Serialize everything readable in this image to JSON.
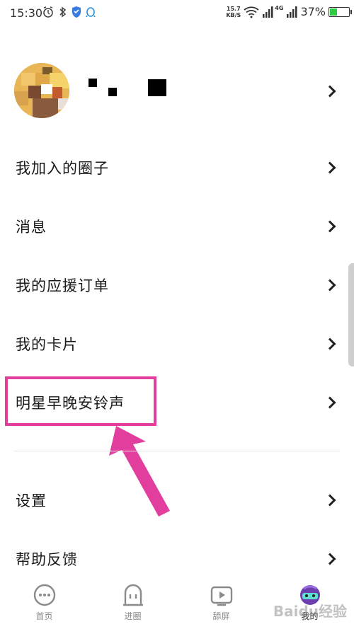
{
  "status_bar": {
    "time": "15:30",
    "net_speed_value": "15.7",
    "net_speed_unit": "KB/S",
    "signal_label": "4G",
    "battery_pct": "37%",
    "battery_level": 0.37
  },
  "profile": {
    "chevron": "chevron-right-icon"
  },
  "menu": {
    "items": [
      {
        "label": "我加入的圈子"
      },
      {
        "label": "消息"
      },
      {
        "label": "我的应援订单"
      },
      {
        "label": "我的卡片"
      },
      {
        "label": "明星早晚安铃声"
      },
      {
        "label": "设置"
      },
      {
        "label": "帮助反馈"
      }
    ]
  },
  "annotation": {
    "highlight_color": "#e23e9e"
  },
  "bottom_tabs": [
    {
      "label": "首页",
      "icon": "chat-bubble-icon"
    },
    {
      "label": "进圈",
      "icon": "door-icon"
    },
    {
      "label": "舔屏",
      "icon": "video-play-icon"
    },
    {
      "label": "我的",
      "icon": "profile-character-icon"
    }
  ],
  "watermark": "Baidu经验"
}
